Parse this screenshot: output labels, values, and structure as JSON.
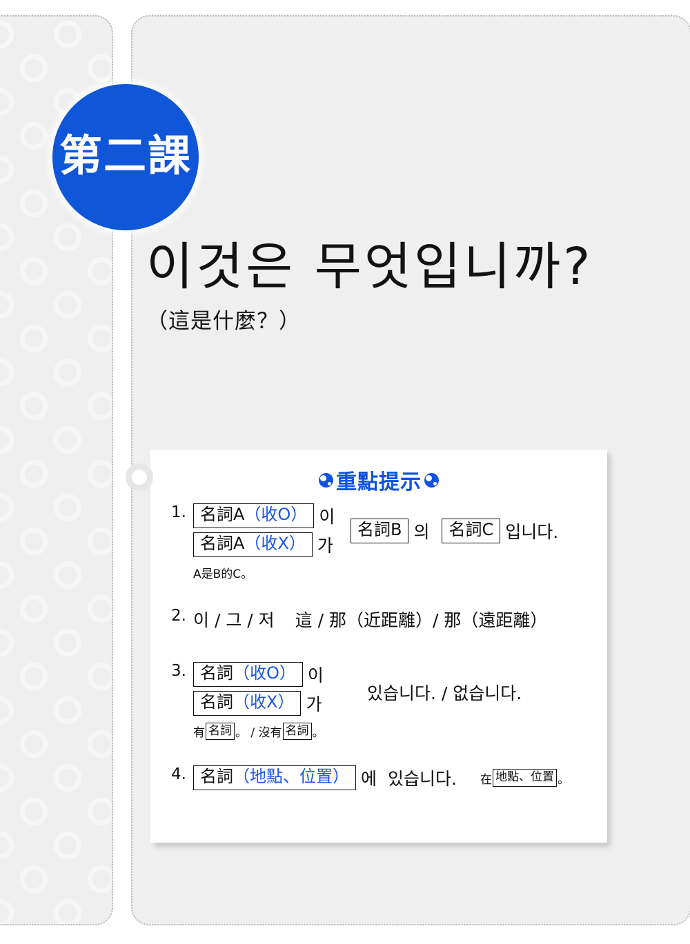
{
  "page": {
    "background_color": "#efefef",
    "accent_color": "#0f56d8"
  },
  "lesson_badge": {
    "label": "第二課"
  },
  "title": {
    "korean": "이것은 무엇입니까?",
    "chinese": "（這是什麼？）"
  },
  "card": {
    "heading": "重點提示",
    "heading_icon_left": "yin-yang-icon",
    "heading_icon_right": "yin-yang-icon",
    "rules": [
      {
        "number": "1.",
        "box_top_prefix": "名詞A",
        "box_top_suffix": "（收O）",
        "particle_top": "이",
        "box_bottom_prefix": "名詞A",
        "box_bottom_suffix": "（收X）",
        "particle_bottom": "가",
        "right_box_b": "名詞B",
        "right_particle_of": "의",
        "right_box_c": "名詞C",
        "right_tail": "입니다.",
        "note": "A是B的C。"
      },
      {
        "number": "2.",
        "korean": "이 / 그 / 저",
        "chinese": "這 / 那（近距離）/ 那（遠距離）"
      },
      {
        "number": "3.",
        "box_top_prefix": "名詞",
        "box_top_suffix": "（收O）",
        "particle_top": "이",
        "box_bottom_prefix": "名詞",
        "box_bottom_suffix": "（收X）",
        "particle_bottom": "가",
        "right_tail": "있습니다. / 없습니다.",
        "note_a": "有",
        "note_box_a": "名詞",
        "note_b": "。 / 沒有",
        "note_box_b": "名詞",
        "note_c": "。"
      },
      {
        "number": "4.",
        "box_prefix": "名詞",
        "box_suffix": "（地點、位置）",
        "particle": "에",
        "tail": "있습니다.",
        "note_a": "在",
        "note_box": "地點、位置",
        "note_b": "。"
      }
    ]
  }
}
